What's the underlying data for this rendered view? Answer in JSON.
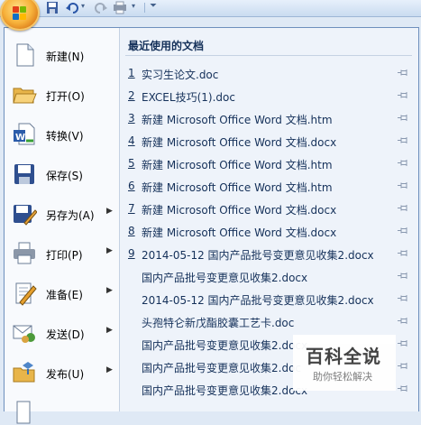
{
  "menu": {
    "items": [
      {
        "label": "新建(N)",
        "icon": "new-document-icon",
        "arrow": false
      },
      {
        "label": "打开(O)",
        "icon": "open-folder-icon",
        "arrow": false
      },
      {
        "label": "转换(V)",
        "icon": "convert-icon",
        "arrow": false
      },
      {
        "label": "保存(S)",
        "icon": "save-icon",
        "arrow": false
      },
      {
        "label": "另存为(A)",
        "icon": "save-as-icon",
        "arrow": true
      },
      {
        "label": "打印(P)",
        "icon": "print-icon",
        "arrow": true
      },
      {
        "label": "准备(E)",
        "icon": "prepare-icon",
        "arrow": true
      },
      {
        "label": "发送(D)",
        "icon": "send-icon",
        "arrow": true
      },
      {
        "label": "发布(U)",
        "icon": "publish-icon",
        "arrow": true
      }
    ]
  },
  "recent": {
    "title": "最近使用的文档",
    "items": [
      {
        "num": "1",
        "name": "实习生论文.doc"
      },
      {
        "num": "2",
        "name": "EXCEL技巧(1).doc"
      },
      {
        "num": "3",
        "name": "新建 Microsoft Office Word 文档.htm"
      },
      {
        "num": "4",
        "name": "新建 Microsoft Office Word 文档.docx"
      },
      {
        "num": "5",
        "name": "新建 Microsoft Office Word 文档.htm"
      },
      {
        "num": "6",
        "name": "新建 Microsoft Office Word 文档.htm"
      },
      {
        "num": "7",
        "name": "新建 Microsoft Office Word 文档.docx"
      },
      {
        "num": "8",
        "name": "新建 Microsoft Office Word 文档.docx"
      },
      {
        "num": "9",
        "name": "2014-05-12 国内产品批号变更意见收集2.docx"
      },
      {
        "num": "",
        "name": "国内产品批号变更意见收集2.docx"
      },
      {
        "num": "",
        "name": "2014-05-12 国内产品批号变更意见收集2.docx"
      },
      {
        "num": "",
        "name": "头孢特仑新戊酯胶囊工艺卡.doc"
      },
      {
        "num": "",
        "name": "国内产品批号变更意见收集2.docx"
      },
      {
        "num": "",
        "name": "国内产品批号变更意见收集2.doc"
      },
      {
        "num": "",
        "name": "国内产品批号变更意见收集2.docx"
      }
    ]
  },
  "watermark": {
    "title": "百科全说",
    "subtitle": "助你轻松解决"
  }
}
